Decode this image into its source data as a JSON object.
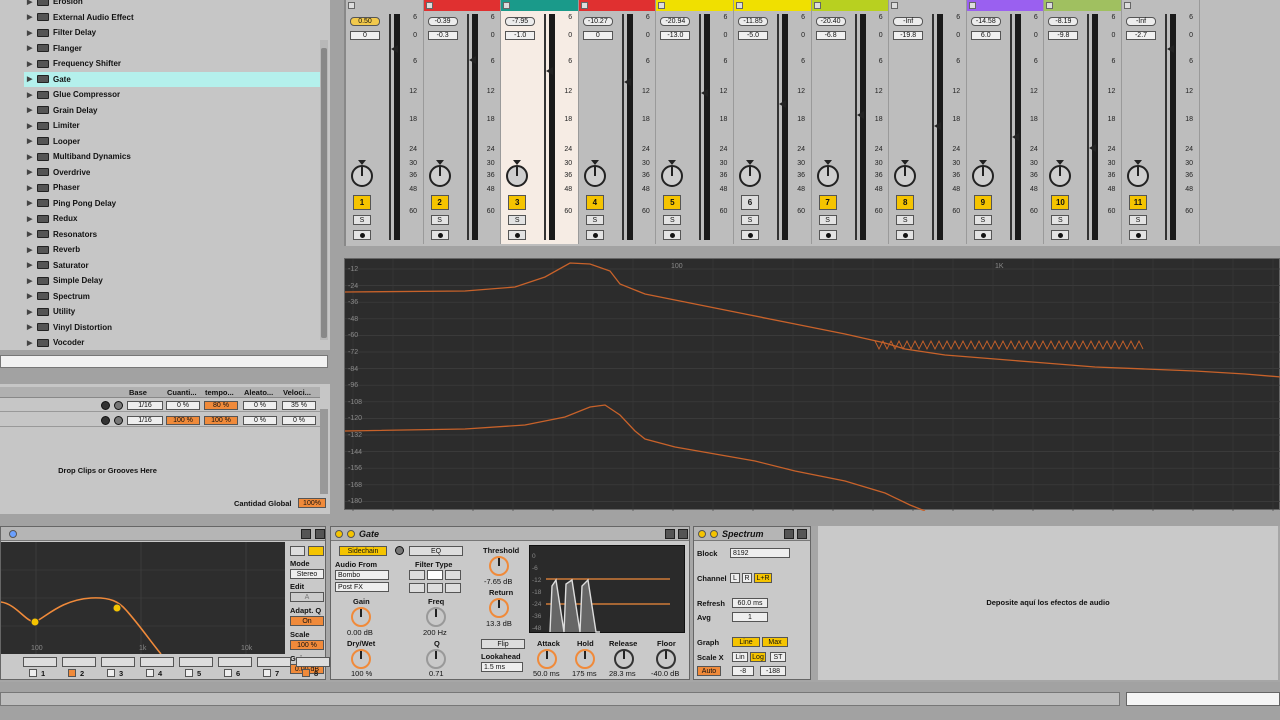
{
  "browser": {
    "items": [
      {
        "label": "Erosion"
      },
      {
        "label": "External Audio Effect"
      },
      {
        "label": "Filter Delay"
      },
      {
        "label": "Flanger"
      },
      {
        "label": "Frequency Shifter"
      },
      {
        "label": "Gate",
        "selected": true
      },
      {
        "label": "Glue Compressor"
      },
      {
        "label": "Grain Delay"
      },
      {
        "label": "Limiter"
      },
      {
        "label": "Looper"
      },
      {
        "label": "Multiband Dynamics"
      },
      {
        "label": "Overdrive"
      },
      {
        "label": "Phaser"
      },
      {
        "label": "Ping Pong Delay"
      },
      {
        "label": "Redux"
      },
      {
        "label": "Resonators"
      },
      {
        "label": "Reverb"
      },
      {
        "label": "Saturator"
      },
      {
        "label": "Simple Delay"
      },
      {
        "label": "Spectrum"
      },
      {
        "label": "Utility"
      },
      {
        "label": "Vinyl Distortion"
      },
      {
        "label": "Vocoder"
      }
    ]
  },
  "groove": {
    "headers": [
      "Base",
      "Cuanti...",
      "tempo...",
      "Aleato...",
      "Veloci..."
    ],
    "rows": [
      {
        "base": "1/16",
        "cuant": "0 %",
        "tempo": "80 %",
        "aleat": "0 %",
        "veloc": "35 %"
      },
      {
        "base": "1/16",
        "cuant": "100 %",
        "tempo": "100 %",
        "aleat": "0 %",
        "veloc": "0 %"
      }
    ],
    "drop_text": "Drop Clips or Grooves Here",
    "global_label": "Cantidad Global",
    "global_value": "100%"
  },
  "mixer": {
    "scale": [
      "6",
      "0",
      "6",
      "12",
      "18",
      "24",
      "30",
      "36",
      "48",
      "60"
    ],
    "tracks": [
      {
        "num": "1",
        "vol": "0.50",
        "peak": "0",
        "color": "#bdbdbd",
        "vol_highlight": true
      },
      {
        "num": "2",
        "vol": "-0.39",
        "peak": "-0.3",
        "color": "#e03030"
      },
      {
        "num": "3",
        "vol": "-7.95",
        "peak": "-1.0",
        "color": "#1a9a8a",
        "selected": true
      },
      {
        "num": "4",
        "vol": "-10.27",
        "peak": "0",
        "color": "#e03030"
      },
      {
        "num": "5",
        "vol": "-20.94",
        "peak": "-13.0",
        "color": "#f0e000"
      },
      {
        "num": "6",
        "vol": "-11.85",
        "peak": "-5.0",
        "color": "#f0e000",
        "gray": true
      },
      {
        "num": "7",
        "vol": "-20.40",
        "peak": "-6.8",
        "color": "#b8d020"
      },
      {
        "num": "8",
        "vol": "-Inf",
        "peak": "-19.8",
        "color": "#bdbdbd"
      },
      {
        "num": "9",
        "vol": "-14.58",
        "peak": "6.0",
        "color": "#9a60f0"
      },
      {
        "num": "10",
        "vol": "-8.19",
        "peak": "-9.8",
        "color": "#a0c060"
      },
      {
        "num": "11",
        "vol": "-Inf",
        "peak": "-2.7",
        "color": "#bdbdbd"
      }
    ],
    "solo_label": "S"
  },
  "spectrum_big": {
    "db_labels": [
      "-12",
      "-24",
      "-36",
      "-48",
      "-60",
      "-72",
      "-84",
      "-96",
      "-108",
      "-120",
      "-132",
      "-144",
      "-156",
      "-168",
      "-180"
    ],
    "freq_labels": [
      "100",
      "1K"
    ]
  },
  "eq": {
    "mode_label": "Mode",
    "mode_value": "Stereo",
    "edit_label": "Edit",
    "edit_value": "A",
    "adapt_label": "Adapt. Q",
    "adapt_value": "On",
    "scale_label": "Scale",
    "scale_value": "100 %",
    "gain_label": "Gain",
    "gain_value": "0.00 dB",
    "freq_labels": [
      "100",
      "1k",
      "10k"
    ],
    "bands": [
      "1",
      "2",
      "3",
      "4",
      "5",
      "6",
      "7",
      "8"
    ]
  },
  "gate": {
    "title": "Gate",
    "sidechain": "Sidechain",
    "eq_btn": "EQ",
    "audio_from_label": "Audio From",
    "audio_from_value": "Bombo",
    "post_fx": "Post FX",
    "filter_type": "Filter Type",
    "gain_label": "Gain",
    "gain_value": "0.00 dB",
    "freq_label": "Freq",
    "freq_value": "200 Hz",
    "drywet_label": "Dry/Wet",
    "drywet_value": "100 %",
    "q_label": "Q",
    "q_value": "0.71",
    "threshold_label": "Threshold",
    "threshold_value": "-7.65 dB",
    "return_label": "Return",
    "return_value": "13.3 dB",
    "flip": "Flip",
    "lookahead_label": "Lookahead",
    "lookahead_value": "1.5 ms",
    "attack_label": "Attack",
    "attack_value": "50.0 ms",
    "hold_label": "Hold",
    "hold_value": "175 ms",
    "release_label": "Release",
    "release_value": "28.3 ms",
    "floor_label": "Floor",
    "floor_value": "-40.0 dB",
    "disp_scale": [
      "0",
      "-6",
      "-12",
      "-18",
      "-24",
      "-36",
      "-48"
    ]
  },
  "spectrum_dev": {
    "title": "Spectrum",
    "block_label": "Block",
    "block_value": "8192",
    "channel_label": "Channel",
    "ch_l": "L",
    "ch_r": "R",
    "ch_lr": "L+R",
    "refresh_label": "Refresh",
    "refresh_value": "60.0 ms",
    "avg_label": "Avg",
    "avg_value": "1",
    "graph_label": "Graph",
    "graph_line": "Line",
    "graph_max": "Max",
    "scalex_label": "Scale X",
    "scalex_lin": "Lin",
    "scalex_log": "Log",
    "scalex_st": "ST",
    "range_label": "Range",
    "auto": "Auto",
    "range_hi": "-8",
    "range_lo": "-188"
  },
  "drop_fx": "Deposite aquí los efectos de audio",
  "colors": {
    "accent_orange": "#f08a3a",
    "track_yellow": "#f5c400",
    "selection": "#b4f0ec"
  }
}
